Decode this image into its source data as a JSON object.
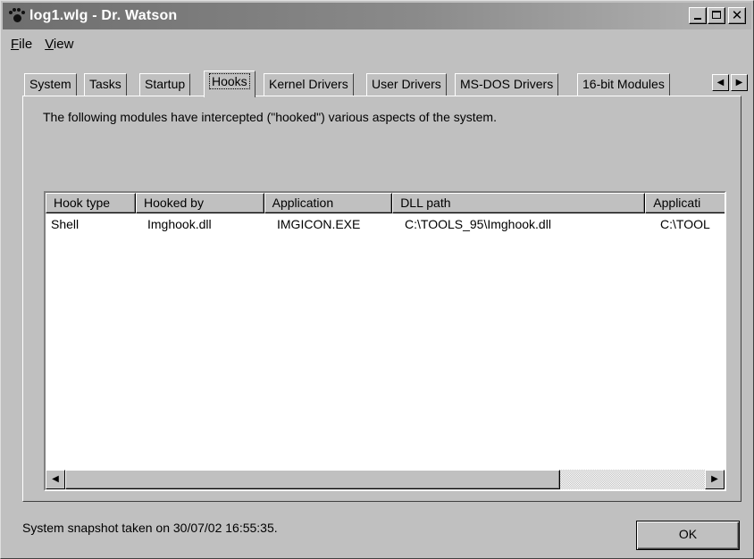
{
  "window": {
    "title": "log1.wlg - Dr. Watson",
    "icon": "dr-watson-paw-icon",
    "controls": {
      "minimize": "minimize-icon",
      "maximize": "maximize-icon",
      "close_glyph": "✕"
    }
  },
  "menu": {
    "file": {
      "accel": "F",
      "rest": "ile"
    },
    "view": {
      "accel": "V",
      "rest": "iew"
    }
  },
  "tabs": [
    {
      "label": "System"
    },
    {
      "label": "Tasks"
    },
    {
      "label": "Startup"
    },
    {
      "label": "Hooks",
      "active": true
    },
    {
      "label": "Kernel Drivers"
    },
    {
      "label": "User Drivers"
    },
    {
      "label": "MS-DOS Drivers"
    },
    {
      "label": "16-bit Modules"
    }
  ],
  "tab_scroll": {
    "left": "◀",
    "right": "▶"
  },
  "description": "The following modules have intercepted (\"hooked\") various aspects of the system.",
  "table": {
    "columns": [
      "Hook type",
      "Hooked by",
      "Application",
      "DLL path",
      "Applicati"
    ],
    "rows": [
      [
        "Shell",
        "Imghook.dll",
        "IMGICON.EXE",
        "C:\\TOOLS_95\\Imghook.dll",
        "C:\\TOOL"
      ]
    ]
  },
  "scrollbar": {
    "left_arrow": "◀",
    "right_arrow": "▶"
  },
  "status_text": "System snapshot taken on 30/07/02 16:55:35.",
  "ok_label": "OK"
}
